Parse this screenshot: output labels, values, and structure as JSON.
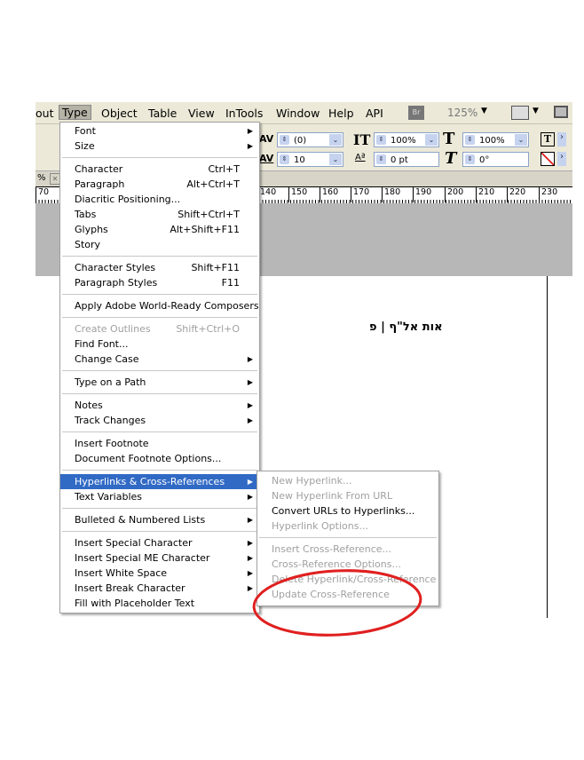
{
  "menubar": {
    "items": [
      "out",
      "Type",
      "Object",
      "Table",
      "View",
      "InTools",
      "Window",
      "Help",
      "API"
    ],
    "bridge": "Br",
    "zoom": "125%"
  },
  "control": {
    "tracking": "(0)",
    "kerning": "10",
    "vscale": "100%",
    "hscale": "100%",
    "baseline": "0 pt",
    "skew": "0°"
  },
  "tabrow": {
    "zoom_frag": "%"
  },
  "ruler": {
    "ticks": [
      "70",
      "140",
      "150",
      "160",
      "170",
      "180",
      "190",
      "200",
      "210",
      "220",
      "230"
    ]
  },
  "document": {
    "text": "אות אל\"ף | פ"
  },
  "type_menu": [
    [
      {
        "label": "Font",
        "arrow": true
      },
      {
        "label": "Size",
        "arrow": true
      }
    ],
    [
      {
        "label": "Character",
        "shortcut": "Ctrl+T"
      },
      {
        "label": "Paragraph",
        "shortcut": "Alt+Ctrl+T"
      },
      {
        "label": "Diacritic Positioning..."
      },
      {
        "label": "Tabs",
        "shortcut": "Shift+Ctrl+T"
      },
      {
        "label": "Glyphs",
        "shortcut": "Alt+Shift+F11"
      },
      {
        "label": "Story"
      }
    ],
    [
      {
        "label": "Character Styles",
        "shortcut": "Shift+F11"
      },
      {
        "label": "Paragraph Styles",
        "shortcut": "F11"
      }
    ],
    [
      {
        "label": "Apply Adobe World-Ready Composers"
      }
    ],
    [
      {
        "label": "Create Outlines",
        "shortcut": "Shift+Ctrl+O",
        "disabled": true
      },
      {
        "label": "Find Font..."
      },
      {
        "label": "Change Case",
        "arrow": true
      }
    ],
    [
      {
        "label": "Type on a Path",
        "arrow": true
      }
    ],
    [
      {
        "label": "Notes",
        "arrow": true
      },
      {
        "label": "Track Changes",
        "arrow": true
      }
    ],
    [
      {
        "label": "Insert Footnote"
      },
      {
        "label": "Document Footnote Options..."
      }
    ],
    [
      {
        "label": "Hyperlinks & Cross-References",
        "arrow": true,
        "selected": true
      },
      {
        "label": "Text Variables",
        "arrow": true
      }
    ],
    [
      {
        "label": "Bulleted & Numbered Lists",
        "arrow": true
      }
    ],
    [
      {
        "label": "Insert Special Character",
        "arrow": true
      },
      {
        "label": "Insert Special ME Character",
        "arrow": true
      },
      {
        "label": "Insert White Space",
        "arrow": true
      },
      {
        "label": "Insert Break Character",
        "arrow": true
      },
      {
        "label": "Fill with Placeholder Text"
      }
    ]
  ],
  "sub_menu": [
    [
      {
        "label": "New Hyperlink...",
        "disabled": true
      },
      {
        "label": "New Hyperlink From URL",
        "disabled": true
      },
      {
        "label": "Convert URLs to Hyperlinks..."
      },
      {
        "label": "Hyperlink Options...",
        "disabled": true
      }
    ],
    [
      {
        "label": "Insert Cross-Reference...",
        "disabled": true
      },
      {
        "label": "Cross-Reference Options...",
        "disabled": true
      },
      {
        "label": "Delete Hyperlink/Cross-Reference",
        "disabled": true
      },
      {
        "label": "Update Cross-Reference",
        "disabled": true
      }
    ]
  ],
  "colors": {
    "highlight": "#316ac5",
    "annotation": "#e02020"
  }
}
